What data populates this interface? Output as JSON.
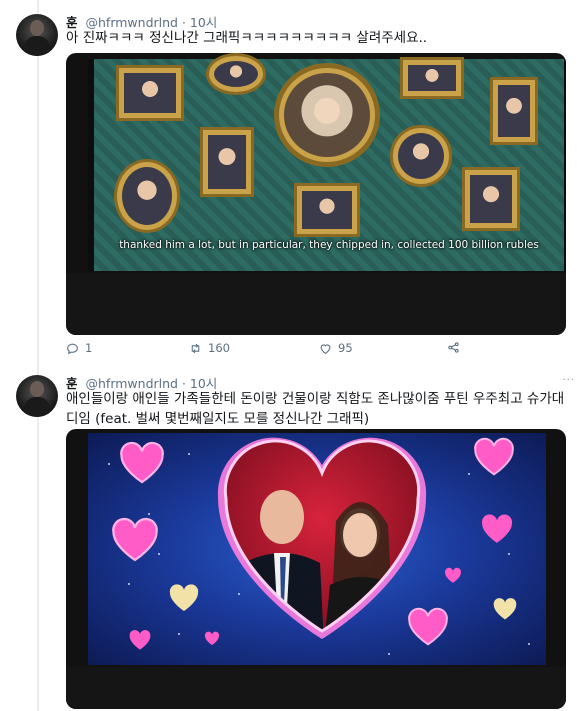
{
  "tweets": [
    {
      "name": "훈",
      "handle": "@hfrmwndrlnd",
      "time": "· 10시",
      "text": "아 진짜ㅋㅋㅋ 정신나간 그래픽ㅋㅋㅋㅋㅋㅋㅋㅋㅋ 살려주세요..",
      "subtitle": "thanked him a lot, but in particular, they chipped in, collected 100 billion rubles",
      "replies": "1",
      "retweets": "160",
      "likes": "95"
    },
    {
      "name": "훈",
      "handle": "@hfrmwndrlnd",
      "time": "· 10시",
      "text": "애인들이랑 애인들 가족들한테 돈이랑 건물이랑 직함도 존나많이줌 푸틴 우주최고 슈가대디임 (feat. 벌써 몇번째일지도 모를 정신나간 그래픽)"
    }
  ],
  "colors": {
    "text": "#14171a",
    "muted": "#5b7083",
    "wallpaper": "#2e6b62",
    "frame_gold": "#c9a24a",
    "heart_pink": "#ff4fc0"
  },
  "icons": [
    "reply-icon",
    "retweet-icon",
    "like-icon",
    "share-icon",
    "more-icon"
  ]
}
